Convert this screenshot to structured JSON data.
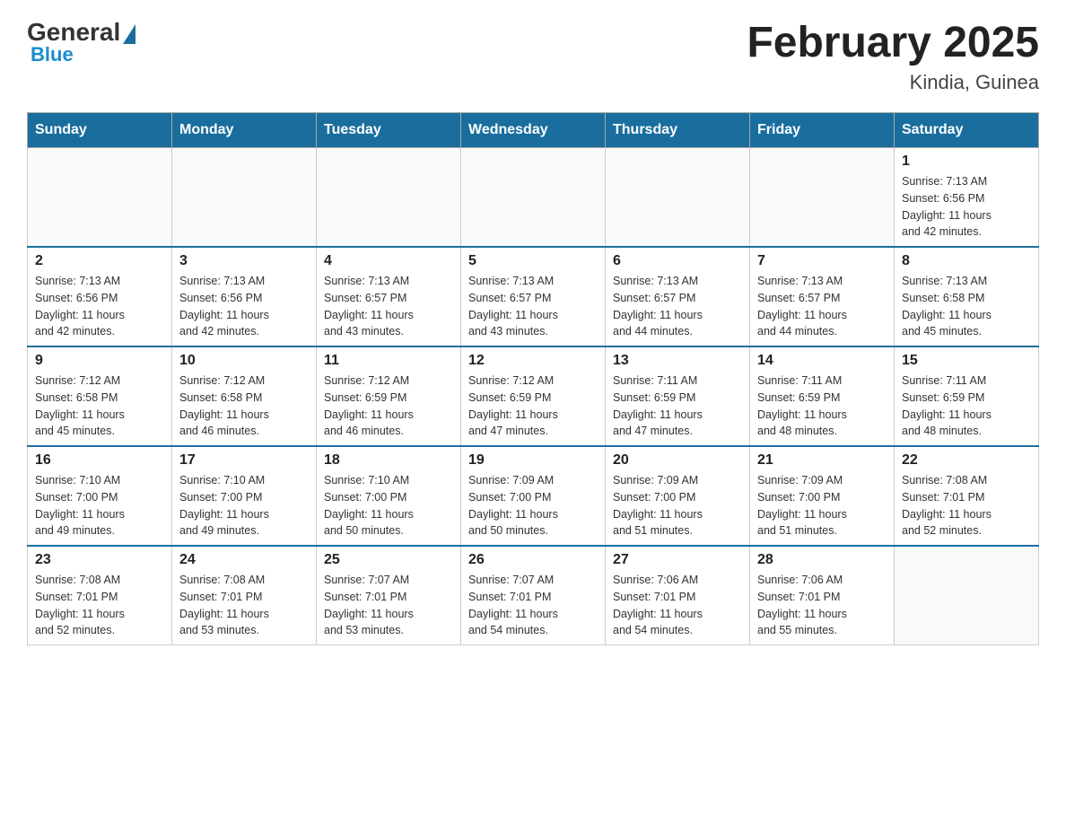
{
  "header": {
    "logo_general": "General",
    "logo_blue": "Blue",
    "main_title": "February 2025",
    "subtitle": "Kindia, Guinea"
  },
  "days_of_week": [
    "Sunday",
    "Monday",
    "Tuesday",
    "Wednesday",
    "Thursday",
    "Friday",
    "Saturday"
  ],
  "weeks": [
    {
      "days": [
        {
          "num": "",
          "info": ""
        },
        {
          "num": "",
          "info": ""
        },
        {
          "num": "",
          "info": ""
        },
        {
          "num": "",
          "info": ""
        },
        {
          "num": "",
          "info": ""
        },
        {
          "num": "",
          "info": ""
        },
        {
          "num": "1",
          "info": "Sunrise: 7:13 AM\nSunset: 6:56 PM\nDaylight: 11 hours\nand 42 minutes."
        }
      ]
    },
    {
      "days": [
        {
          "num": "2",
          "info": "Sunrise: 7:13 AM\nSunset: 6:56 PM\nDaylight: 11 hours\nand 42 minutes."
        },
        {
          "num": "3",
          "info": "Sunrise: 7:13 AM\nSunset: 6:56 PM\nDaylight: 11 hours\nand 42 minutes."
        },
        {
          "num": "4",
          "info": "Sunrise: 7:13 AM\nSunset: 6:57 PM\nDaylight: 11 hours\nand 43 minutes."
        },
        {
          "num": "5",
          "info": "Sunrise: 7:13 AM\nSunset: 6:57 PM\nDaylight: 11 hours\nand 43 minutes."
        },
        {
          "num": "6",
          "info": "Sunrise: 7:13 AM\nSunset: 6:57 PM\nDaylight: 11 hours\nand 44 minutes."
        },
        {
          "num": "7",
          "info": "Sunrise: 7:13 AM\nSunset: 6:57 PM\nDaylight: 11 hours\nand 44 minutes."
        },
        {
          "num": "8",
          "info": "Sunrise: 7:13 AM\nSunset: 6:58 PM\nDaylight: 11 hours\nand 45 minutes."
        }
      ]
    },
    {
      "days": [
        {
          "num": "9",
          "info": "Sunrise: 7:12 AM\nSunset: 6:58 PM\nDaylight: 11 hours\nand 45 minutes."
        },
        {
          "num": "10",
          "info": "Sunrise: 7:12 AM\nSunset: 6:58 PM\nDaylight: 11 hours\nand 46 minutes."
        },
        {
          "num": "11",
          "info": "Sunrise: 7:12 AM\nSunset: 6:59 PM\nDaylight: 11 hours\nand 46 minutes."
        },
        {
          "num": "12",
          "info": "Sunrise: 7:12 AM\nSunset: 6:59 PM\nDaylight: 11 hours\nand 47 minutes."
        },
        {
          "num": "13",
          "info": "Sunrise: 7:11 AM\nSunset: 6:59 PM\nDaylight: 11 hours\nand 47 minutes."
        },
        {
          "num": "14",
          "info": "Sunrise: 7:11 AM\nSunset: 6:59 PM\nDaylight: 11 hours\nand 48 minutes."
        },
        {
          "num": "15",
          "info": "Sunrise: 7:11 AM\nSunset: 6:59 PM\nDaylight: 11 hours\nand 48 minutes."
        }
      ]
    },
    {
      "days": [
        {
          "num": "16",
          "info": "Sunrise: 7:10 AM\nSunset: 7:00 PM\nDaylight: 11 hours\nand 49 minutes."
        },
        {
          "num": "17",
          "info": "Sunrise: 7:10 AM\nSunset: 7:00 PM\nDaylight: 11 hours\nand 49 minutes."
        },
        {
          "num": "18",
          "info": "Sunrise: 7:10 AM\nSunset: 7:00 PM\nDaylight: 11 hours\nand 50 minutes."
        },
        {
          "num": "19",
          "info": "Sunrise: 7:09 AM\nSunset: 7:00 PM\nDaylight: 11 hours\nand 50 minutes."
        },
        {
          "num": "20",
          "info": "Sunrise: 7:09 AM\nSunset: 7:00 PM\nDaylight: 11 hours\nand 51 minutes."
        },
        {
          "num": "21",
          "info": "Sunrise: 7:09 AM\nSunset: 7:00 PM\nDaylight: 11 hours\nand 51 minutes."
        },
        {
          "num": "22",
          "info": "Sunrise: 7:08 AM\nSunset: 7:01 PM\nDaylight: 11 hours\nand 52 minutes."
        }
      ]
    },
    {
      "days": [
        {
          "num": "23",
          "info": "Sunrise: 7:08 AM\nSunset: 7:01 PM\nDaylight: 11 hours\nand 52 minutes."
        },
        {
          "num": "24",
          "info": "Sunrise: 7:08 AM\nSunset: 7:01 PM\nDaylight: 11 hours\nand 53 minutes."
        },
        {
          "num": "25",
          "info": "Sunrise: 7:07 AM\nSunset: 7:01 PM\nDaylight: 11 hours\nand 53 minutes."
        },
        {
          "num": "26",
          "info": "Sunrise: 7:07 AM\nSunset: 7:01 PM\nDaylight: 11 hours\nand 54 minutes."
        },
        {
          "num": "27",
          "info": "Sunrise: 7:06 AM\nSunset: 7:01 PM\nDaylight: 11 hours\nand 54 minutes."
        },
        {
          "num": "28",
          "info": "Sunrise: 7:06 AM\nSunset: 7:01 PM\nDaylight: 11 hours\nand 55 minutes."
        },
        {
          "num": "",
          "info": ""
        }
      ]
    }
  ]
}
